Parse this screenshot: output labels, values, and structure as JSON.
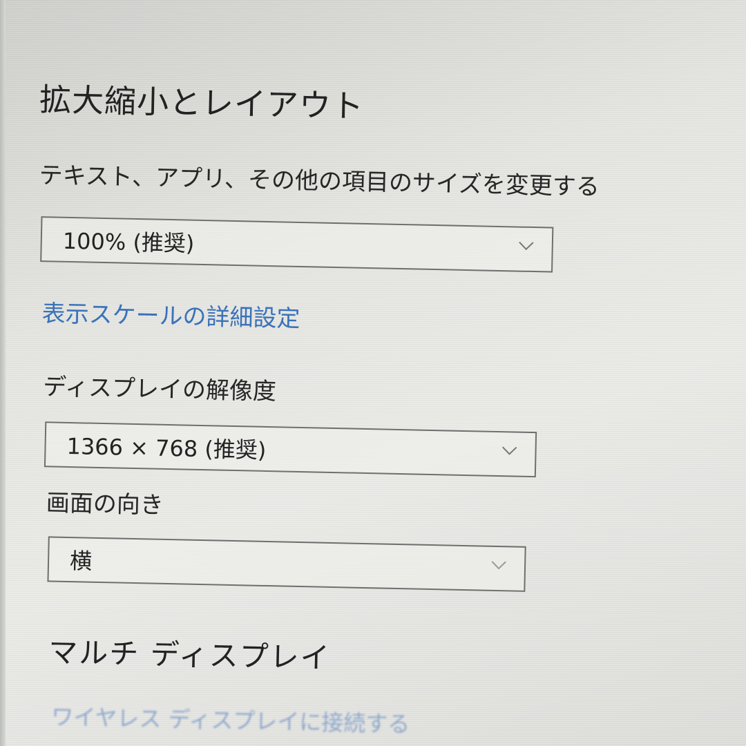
{
  "section": {
    "title": "拡大縮小とレイアウト"
  },
  "scale": {
    "label": "テキスト、アプリ、その他の項目のサイズを変更する",
    "value": "100% (推奨)",
    "advanced_link": "表示スケールの詳細設定"
  },
  "resolution": {
    "label": "ディスプレイの解像度",
    "value": "1366 × 768 (推奨)"
  },
  "orientation": {
    "label": "画面の向き",
    "value": "横"
  },
  "multi_display": {
    "title": "マルチ ディスプレイ",
    "wireless_link": "ワイヤレス ディスプレイに接続する"
  },
  "icons": {
    "dropdown": "chevron-down-icon"
  }
}
